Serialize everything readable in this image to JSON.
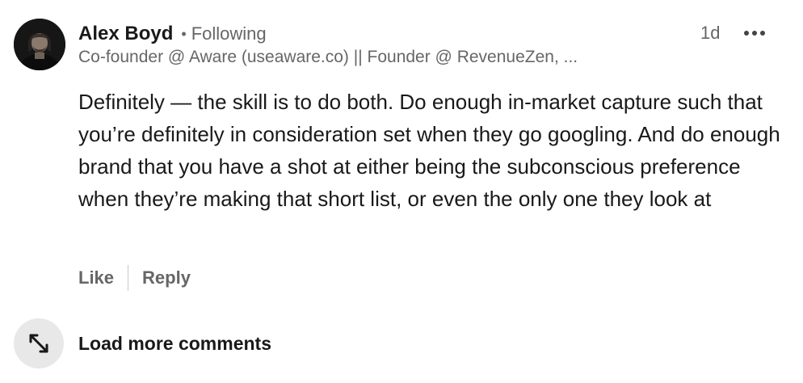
{
  "comment": {
    "author": {
      "name": "Alex Boyd",
      "separator": "•",
      "follow_status": "Following",
      "headline": "Co-founder @ Aware (useaware.co) || Founder @ RevenueZen, ..."
    },
    "timestamp": "1d",
    "more_icon": "more-horizontal-icon",
    "body_text": "Definitely — the skill is to do both. Do enough in-market capture such that you’re definitely in consideration set when they go googling. And do enough brand that you have a shot at either being the subconscious preference when they’re making that short list, or even the only one they look at",
    "actions": {
      "like_label": "Like",
      "reply_label": "Reply"
    }
  },
  "load_more": {
    "label": "Load more comments",
    "icon": "expand-arrows-icon"
  }
}
